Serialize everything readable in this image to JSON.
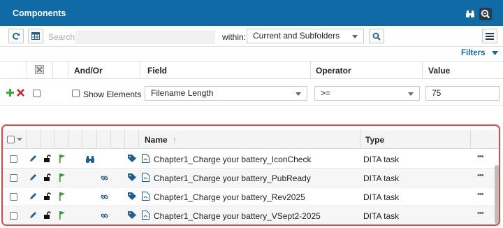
{
  "panel": {
    "title": "Components"
  },
  "toolbar": {
    "search_label": "Search:",
    "search_value": "",
    "within_label": "within:",
    "within_value": "Current and Subfolders"
  },
  "filters": {
    "link_label": "Filters",
    "columns": [
      "And/Or",
      "Field",
      "Operator",
      "Value"
    ],
    "row": {
      "show_elements_label": "Show Elements",
      "field_value": "Filename Length",
      "operator_value": ">=",
      "value": "75"
    }
  },
  "grid": {
    "columns": {
      "name": "Name",
      "name_sort_icon": "↑",
      "type": "Type"
    },
    "rows": [
      {
        "name": "Chapter1_Charge your battery_IconCheck",
        "type": "DITA task",
        "status_icon": "binoculars-icon",
        "more": "•••"
      },
      {
        "name": "Chapter1_Charge your battery_PubReady",
        "type": "DITA task",
        "status_icon": "link-icon",
        "more": "•••"
      },
      {
        "name": "Chapter1_Charge your battery_Rev2025",
        "type": "DITA task",
        "status_icon": "link-icon",
        "more": "•••"
      },
      {
        "name": "Chapter1_Charge your battery_VSept2-2025",
        "type": "DITA task",
        "status_icon": "link-icon",
        "more": "•••"
      }
    ]
  },
  "colors": {
    "header_blue": "#0f6aa6",
    "highlight_red": "#e0473e",
    "flag_green": "#2e9a2e",
    "add_green": "#3aa83a",
    "remove_red": "#cc2222"
  }
}
